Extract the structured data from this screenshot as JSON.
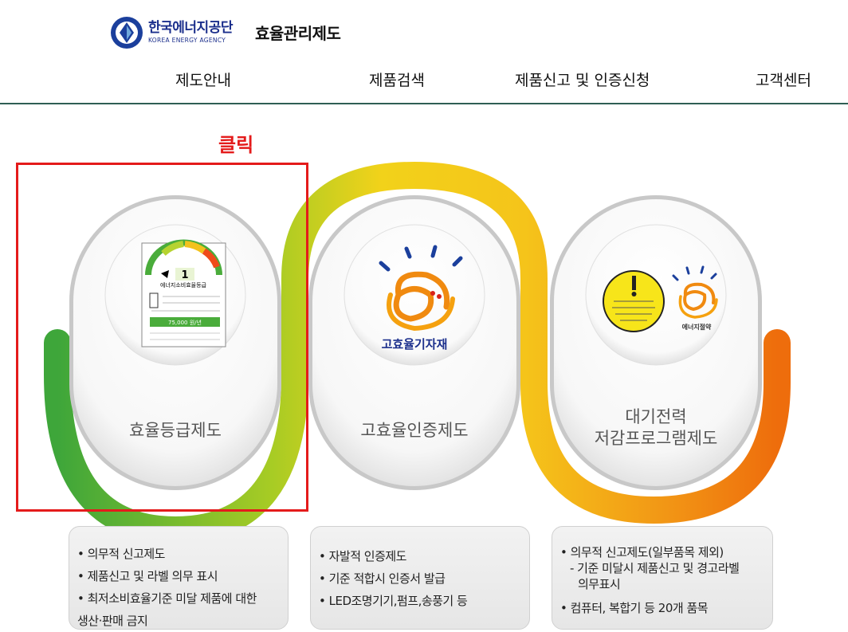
{
  "header": {
    "agency_kr": "한국에너지공단",
    "agency_en": "KOREA ENERGY AGENCY",
    "site_title": "효율관리제도"
  },
  "nav": {
    "items": [
      "제도안내",
      "제품검색",
      "제품신고 및 인증신청",
      "고객센터"
    ]
  },
  "annotation": {
    "click_label": "클릭"
  },
  "programs": [
    {
      "label": "효율등급제도",
      "icon_label": "에너지소비효율등급",
      "grade": "1",
      "cost": "75,000 원/년",
      "bullets": [
        "• 의무적 신고제도",
        "• 제품신고 및 라벨 의무 표시",
        "• 최저소비효율기준 미달 제품에 대한",
        "  생산·판매 금지"
      ]
    },
    {
      "label": "고효율인증제도",
      "icon_label": "고효율기자재",
      "bullets": [
        "• 자발적 인증제도",
        "• 기준 적합시 인증서 발급",
        "• LED조명기기,펌프,송풍기 등"
      ]
    },
    {
      "label_line1": "대기전력",
      "label_line2": "저감프로그램제도",
      "icon_label": "에너지절약",
      "bullets": [
        "• 의무적 신고제도(일부품목 제외)",
        "- 기준 미달시 제품신고 및 경고라벨",
        "의무표시",
        "• 컴퓨터, 복합기 등 20개 품목"
      ]
    }
  ],
  "colors": {
    "brand_blue": "#1b2f8c",
    "highlight_red": "#e41b1b",
    "band_green": "#4aac3b",
    "band_yellow": "#f2c21c",
    "band_orange": "#ef7a10"
  }
}
